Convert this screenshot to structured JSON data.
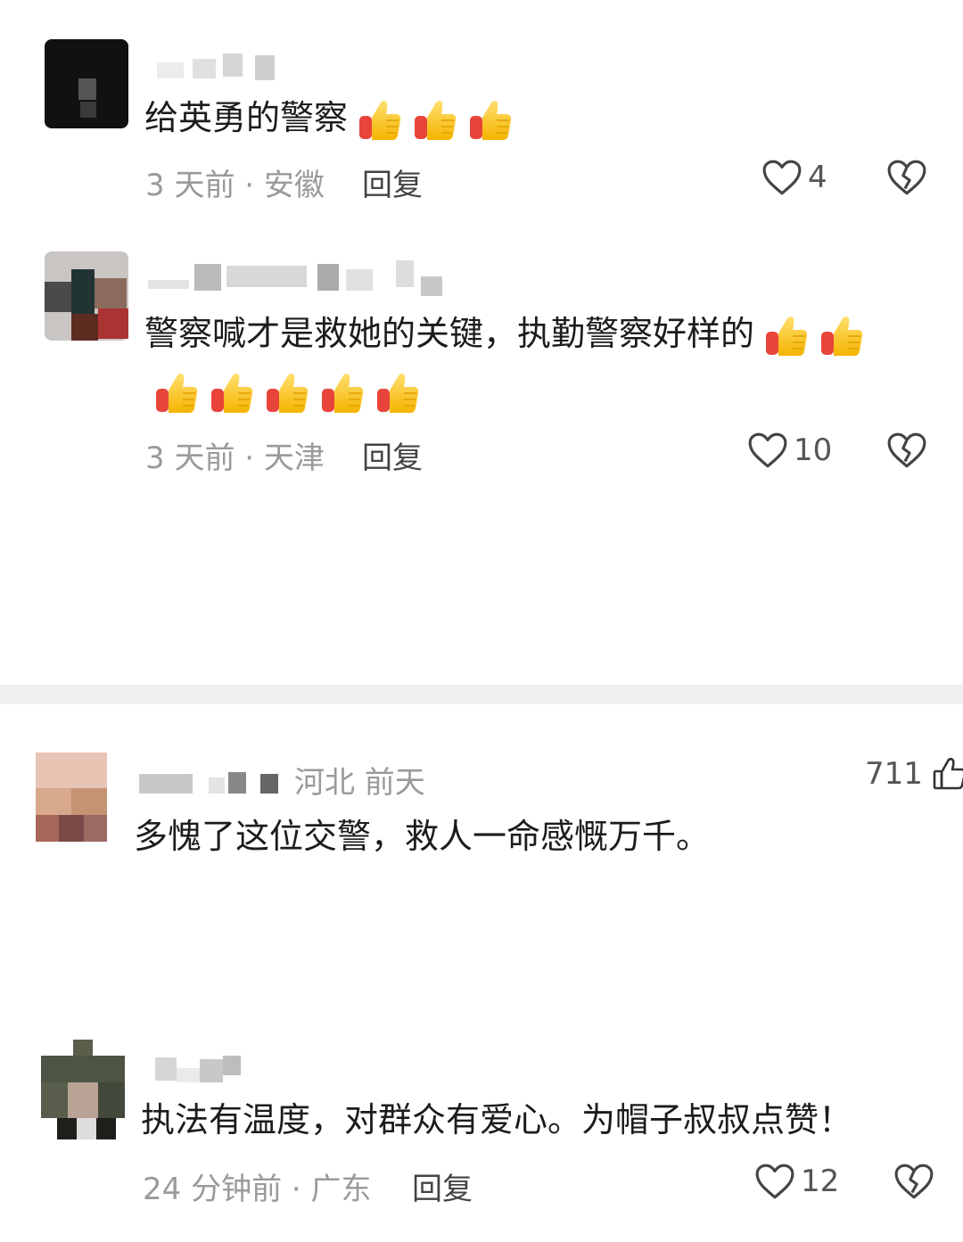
{
  "comments_section_a": [
    {
      "text": "给英勇的警察",
      "emoji_count": 3,
      "time_location": "3 天前 · 安徽",
      "reply_label": "回复",
      "like_count": "4"
    },
    {
      "text_line1": "警察喊才是救她的关键，执勤警察好样的",
      "emoji_count_line1": 2,
      "emoji_count_line2": 5,
      "time_location": "3 天前 · 天津",
      "reply_label": "回复",
      "like_count": "10"
    }
  ],
  "comments_section_b": [
    {
      "meta": "河北 前天",
      "like_count": "711",
      "text": "多愧了这位交警，救人一命感慨万千。"
    },
    {
      "text": "执法有温度，对群众有爱心。为帽子叔叔点赞！",
      "time_location": "24 分钟前 · 广东",
      "reply_label": "回复",
      "like_count": "12"
    }
  ],
  "icons": {
    "heart": "heart-outline-icon",
    "broken_heart": "broken-heart-icon",
    "thumbs_up_emoji": "thumbs-up-emoji",
    "thumbs_up_outline": "thumbs-up-outline-icon"
  },
  "colors": {
    "emoji_yellow": "#ffcc33",
    "emoji_red": "#e8443a",
    "meta_gray": "#9a9a9a",
    "divider": "#efefef"
  }
}
